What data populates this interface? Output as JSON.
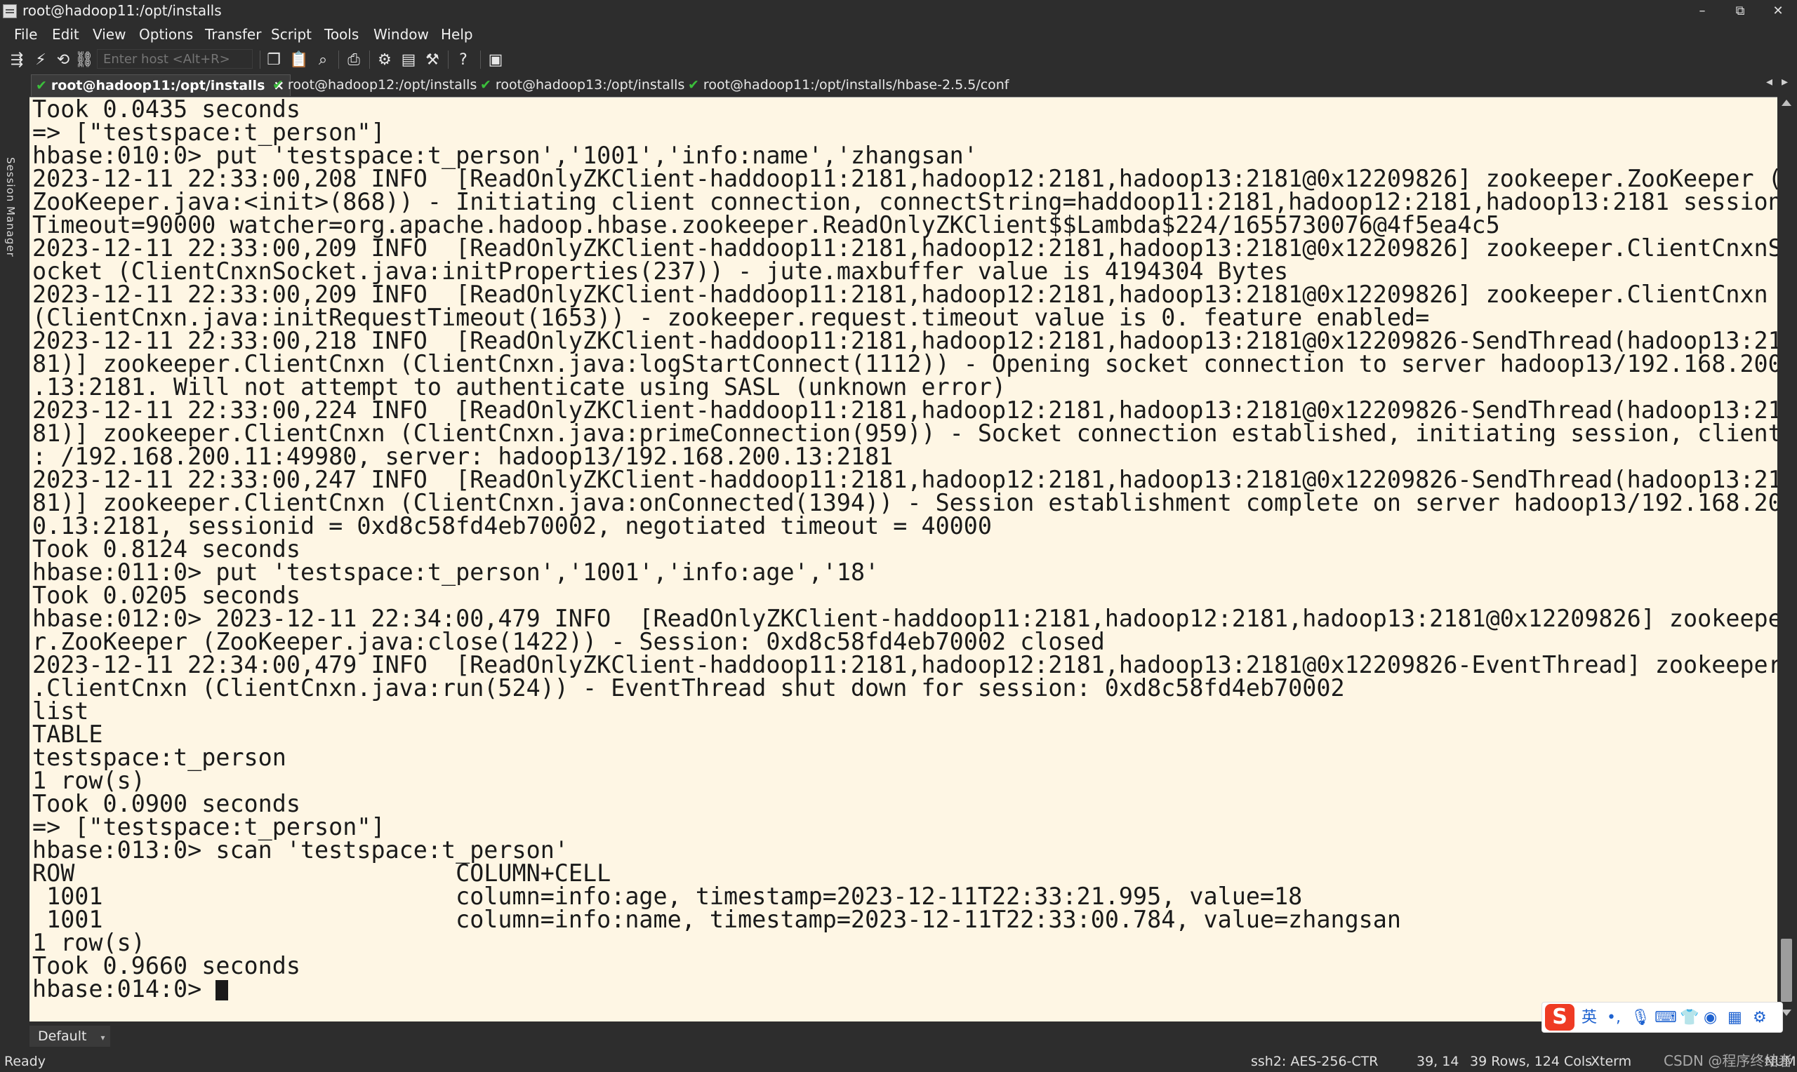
{
  "window": {
    "title": "root@hadoop11:/opt/installs",
    "controls": {
      "minimize": "–",
      "restore": "⧉",
      "close": "✕"
    }
  },
  "menu": [
    "File",
    "Edit",
    "View",
    "Options",
    "Transfer",
    "Script",
    "Tools",
    "Window",
    "Help"
  ],
  "toolbar": {
    "host_placeholder": "Enter host <Alt+R>",
    "icons": [
      "connect-icon",
      "quick-connect-icon",
      "reconnect-icon",
      "disconnect-icon",
      "copy-icon",
      "paste-icon",
      "find-icon",
      "print-icon",
      "settings-icon",
      "sftp-icon",
      "keymap-icon",
      "help-icon",
      "sessions-icon"
    ]
  },
  "sidebar": {
    "label": "Session Manager"
  },
  "tabs": [
    {
      "label": "root@hadoop11:/opt/installs",
      "active": true,
      "close": "×"
    },
    {
      "label": "root@hadoop12:/opt/installs",
      "active": false
    },
    {
      "label": "root@hadoop13:/opt/installs",
      "active": false
    },
    {
      "label": "root@hadoop11:/opt/installs/hbase-2.5.5/conf",
      "active": false
    }
  ],
  "tab_nav": {
    "prev": "◂",
    "next": "▸"
  },
  "terminal": {
    "lines": [
      "Took 0.0435 seconds",
      "=> [\"testspace:t_person\"]",
      "hbase:010:0> put 'testspace:t_person','1001','info:name','zhangsan'",
      "2023-12-11 22:33:00,208 INFO  [ReadOnlyZKClient-haddoop11:2181,hadoop12:2181,hadoop13:2181@0x12209826] zookeeper.ZooKeeper (",
      "ZooKeeper.java:<init>(868)) - Initiating client connection, connectString=haddoop11:2181,hadoop12:2181,hadoop13:2181 session",
      "Timeout=90000 watcher=org.apache.hadoop.hbase.zookeeper.ReadOnlyZKClient$$Lambda$224/1655730076@4f5ea4c5",
      "2023-12-11 22:33:00,209 INFO  [ReadOnlyZKClient-haddoop11:2181,hadoop12:2181,hadoop13:2181@0x12209826] zookeeper.ClientCnxnS",
      "ocket (ClientCnxnSocket.java:initProperties(237)) - jute.maxbuffer value is 4194304 Bytes",
      "2023-12-11 22:33:00,209 INFO  [ReadOnlyZKClient-haddoop11:2181,hadoop12:2181,hadoop13:2181@0x12209826] zookeeper.ClientCnxn",
      "(ClientCnxn.java:initRequestTimeout(1653)) - zookeeper.request.timeout value is 0. feature enabled=",
      "2023-12-11 22:33:00,218 INFO  [ReadOnlyZKClient-haddoop11:2181,hadoop12:2181,hadoop13:2181@0x12209826-SendThread(hadoop13:21",
      "81)] zookeeper.ClientCnxn (ClientCnxn.java:logStartConnect(1112)) - Opening socket connection to server hadoop13/192.168.200",
      ".13:2181. Will not attempt to authenticate using SASL (unknown error)",
      "2023-12-11 22:33:00,224 INFO  [ReadOnlyZKClient-haddoop11:2181,hadoop12:2181,hadoop13:2181@0x12209826-SendThread(hadoop13:21",
      "81)] zookeeper.ClientCnxn (ClientCnxn.java:primeConnection(959)) - Socket connection established, initiating session, client",
      ": /192.168.200.11:49980, server: hadoop13/192.168.200.13:2181",
      "2023-12-11 22:33:00,247 INFO  [ReadOnlyZKClient-haddoop11:2181,hadoop12:2181,hadoop13:2181@0x12209826-SendThread(hadoop13:21",
      "81)] zookeeper.ClientCnxn (ClientCnxn.java:onConnected(1394)) - Session establishment complete on server hadoop13/192.168.20",
      "0.13:2181, sessionid = 0xd8c58fd4eb70002, negotiated timeout = 40000",
      "Took 0.8124 seconds",
      "hbase:011:0> put 'testspace:t_person','1001','info:age','18'",
      "Took 0.0205 seconds",
      "hbase:012:0> 2023-12-11 22:34:00,479 INFO  [ReadOnlyZKClient-haddoop11:2181,hadoop12:2181,hadoop13:2181@0x12209826] zookeepe",
      "r.ZooKeeper (ZooKeeper.java:close(1422)) - Session: 0xd8c58fd4eb70002 closed",
      "2023-12-11 22:34:00,479 INFO  [ReadOnlyZKClient-haddoop11:2181,hadoop12:2181,hadoop13:2181@0x12209826-EventThread] zookeeper",
      ".ClientCnxn (ClientCnxn.java:run(524)) - EventThread shut down for session: 0xd8c58fd4eb70002",
      "list",
      "TABLE",
      "testspace:t_person",
      "1 row(s)",
      "Took 0.0900 seconds",
      "=> [\"testspace:t_person\"]",
      "hbase:013:0> scan 'testspace:t_person'",
      "ROW                           COLUMN+CELL",
      " 1001                         column=info:age, timestamp=2023-12-11T22:33:21.995, value=18",
      " 1001                         column=info:name, timestamp=2023-12-11T22:33:00.784, value=zhangsan",
      "1 row(s)",
      "Took 0.9660 seconds"
    ],
    "prompt": "hbase:014:0> "
  },
  "button_bar": {
    "default_label": "Default",
    "arrow": "▾"
  },
  "ime": {
    "logo": "S",
    "lang": "英"
  },
  "status": {
    "ready": "Ready",
    "protocol": "ssh2: AES-256-CTR",
    "cursor_pos": "39, 14",
    "size": "39 Rows, 124 Cols",
    "term_type": "Xterm",
    "num": "NUM"
  },
  "watermark": "CSDN @程序终结者"
}
